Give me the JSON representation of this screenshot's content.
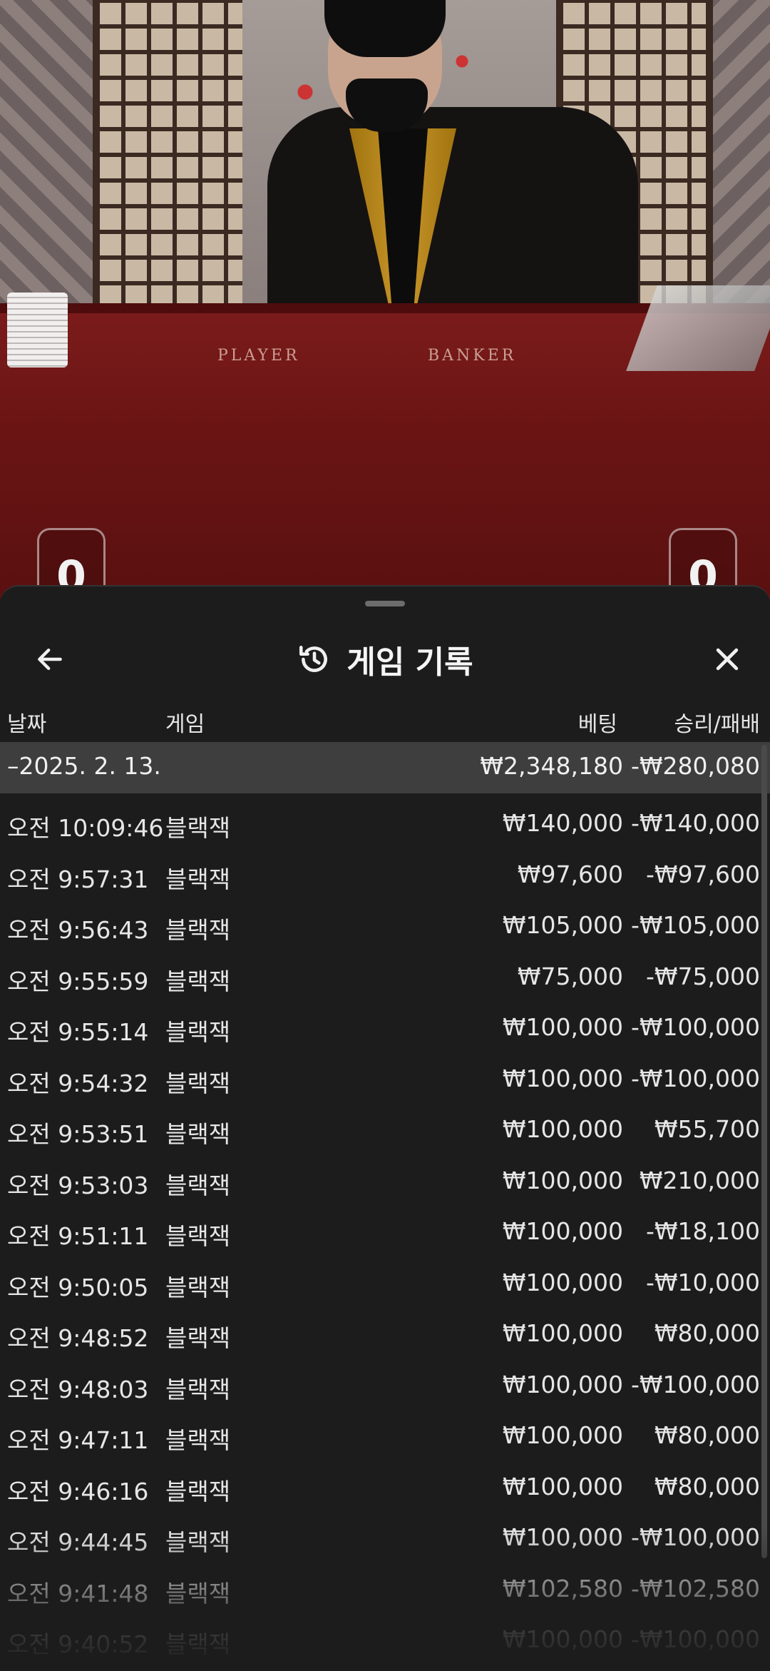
{
  "video": {
    "felt_labels": [
      "PLAYER",
      "BANKER"
    ],
    "scores": [
      "0",
      "0"
    ]
  },
  "sheet": {
    "title": "게임 기록",
    "icons": {
      "back": "arrow-left-icon",
      "history": "history-icon",
      "close": "close-icon"
    }
  },
  "columns": {
    "date": "날짜",
    "game": "게임",
    "bet": "베팅",
    "winloss": "승리/패배"
  },
  "group": {
    "date": "–2025. 2. 13.",
    "bet": "₩2,348,180",
    "winloss": "-₩280,080"
  },
  "rows": [
    {
      "time": "오전 10:09:46",
      "game": "블랙잭",
      "bet": "₩140,000",
      "winloss": "-₩140,000"
    },
    {
      "time": "오전 9:57:31",
      "game": "블랙잭",
      "bet": "₩97,600",
      "winloss": "-₩97,600"
    },
    {
      "time": "오전 9:56:43",
      "game": "블랙잭",
      "bet": "₩105,000",
      "winloss": "-₩105,000"
    },
    {
      "time": "오전 9:55:59",
      "game": "블랙잭",
      "bet": "₩75,000",
      "winloss": "-₩75,000"
    },
    {
      "time": "오전 9:55:14",
      "game": "블랙잭",
      "bet": "₩100,000",
      "winloss": "-₩100,000"
    },
    {
      "time": "오전 9:54:32",
      "game": "블랙잭",
      "bet": "₩100,000",
      "winloss": "-₩100,000"
    },
    {
      "time": "오전 9:53:51",
      "game": "블랙잭",
      "bet": "₩100,000",
      "winloss": "₩55,700"
    },
    {
      "time": "오전 9:53:03",
      "game": "블랙잭",
      "bet": "₩100,000",
      "winloss": "₩210,000"
    },
    {
      "time": "오전 9:51:11",
      "game": "블랙잭",
      "bet": "₩100,000",
      "winloss": "-₩18,100"
    },
    {
      "time": "오전 9:50:05",
      "game": "블랙잭",
      "bet": "₩100,000",
      "winloss": "-₩10,000"
    },
    {
      "time": "오전 9:48:52",
      "game": "블랙잭",
      "bet": "₩100,000",
      "winloss": "₩80,000"
    },
    {
      "time": "오전 9:48:03",
      "game": "블랙잭",
      "bet": "₩100,000",
      "winloss": "-₩100,000"
    },
    {
      "time": "오전 9:47:11",
      "game": "블랙잭",
      "bet": "₩100,000",
      "winloss": "₩80,000"
    },
    {
      "time": "오전 9:46:16",
      "game": "블랙잭",
      "bet": "₩100,000",
      "winloss": "₩80,000"
    },
    {
      "time": "오전 9:44:45",
      "game": "블랙잭",
      "bet": "₩100,000",
      "winloss": "-₩100,000"
    },
    {
      "time": "오전 9:41:48",
      "game": "블랙잭",
      "bet": "₩102,580",
      "winloss": "-₩102,580"
    },
    {
      "time": "오전 9:40:52",
      "game": "블랙잭",
      "bet": "₩100,000",
      "winloss": "-₩100,000"
    }
  ]
}
